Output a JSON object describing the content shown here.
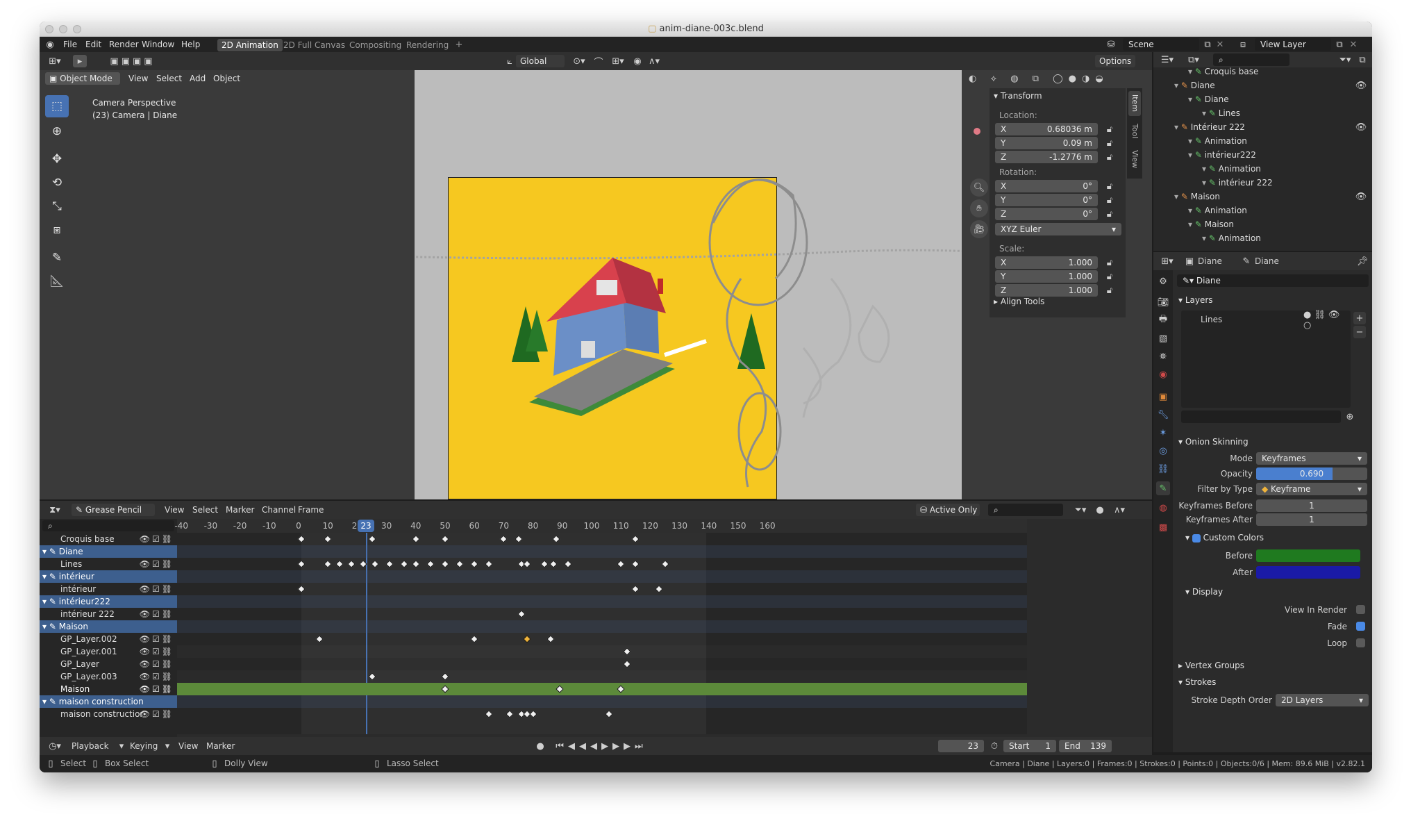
{
  "title": "anim-diane-003c.blend",
  "menu": [
    "File",
    "Edit",
    "Render",
    "Window",
    "Help"
  ],
  "workspaces": [
    {
      "label": "2D Animation",
      "active": true
    },
    {
      "label": "2D Full Canvas",
      "active": false
    },
    {
      "label": "Compositing",
      "active": false
    },
    {
      "label": "Rendering",
      "active": false
    }
  ],
  "scene": "Scene",
  "view_layer": "View Layer",
  "viewport": {
    "orientation": "Global",
    "options": "Options",
    "mode": "Object Mode",
    "menus": [
      "View",
      "Select",
      "Add",
      "Object"
    ],
    "info_line1": "Camera Perspective",
    "info_line2": "(23) Camera | Diane"
  },
  "npanel": {
    "tabs": [
      "Item",
      "Tool",
      "View"
    ],
    "transform_header": "Transform",
    "location_label": "Location:",
    "location": [
      {
        "axis": "X",
        "value": "0.68036 m"
      },
      {
        "axis": "Y",
        "value": "0.09 m"
      },
      {
        "axis": "Z",
        "value": "-1.2776 m"
      }
    ],
    "rotation_label": "Rotation:",
    "rotation": [
      {
        "axis": "X",
        "value": "0°"
      },
      {
        "axis": "Y",
        "value": "0°"
      },
      {
        "axis": "Z",
        "value": "0°"
      }
    ],
    "rotation_mode": "XYZ Euler",
    "scale_label": "Scale:",
    "scale": [
      {
        "axis": "X",
        "value": "1.000"
      },
      {
        "axis": "Y",
        "value": "1.000"
      },
      {
        "axis": "Z",
        "value": "1.000"
      }
    ],
    "align_tools": "Align Tools"
  },
  "outliner": {
    "items": [
      {
        "label": "Croquis base",
        "indent": 5
      },
      {
        "label": "Diane",
        "indent": 3
      },
      {
        "label": "Diane",
        "indent": 5
      },
      {
        "label": "Lines",
        "indent": 7
      },
      {
        "label": "Intérieur 222",
        "indent": 3
      },
      {
        "label": "Animation",
        "indent": 5
      },
      {
        "label": "intérieur222",
        "indent": 5
      },
      {
        "label": "Animation",
        "indent": 7
      },
      {
        "label": "intérieur 222",
        "indent": 7
      },
      {
        "label": "Maison",
        "indent": 3
      },
      {
        "label": "Animation",
        "indent": 5
      },
      {
        "label": "Maison",
        "indent": 5
      },
      {
        "label": "Animation",
        "indent": 7
      }
    ]
  },
  "properties": {
    "breadcrumb_object": "Diane",
    "breadcrumb_data": "Diane",
    "data_name": "Diane",
    "layers_header": "Layers",
    "layer_item": "Lines",
    "onion_header": "Onion Skinning",
    "mode_label": "Mode",
    "mode_value": "Keyframes",
    "opacity_label": "Opacity",
    "opacity_value": "0.690",
    "opacity_fraction": 0.69,
    "filter_label": "Filter by Type",
    "filter_value": "Keyframe",
    "kf_before_label": "Keyframes Before",
    "kf_before_value": "1",
    "kf_after_label": "Keyframes After",
    "kf_after_value": "1",
    "custom_colors": "Custom Colors",
    "before_label": "Before",
    "before_color": "#1f7a1f",
    "after_label": "After",
    "after_color": "#1a1aa6",
    "display_header": "Display",
    "view_in_render": "View In Render",
    "fade": "Fade",
    "loop": "Loop",
    "vertex_groups": "Vertex Groups",
    "strokes": "Strokes",
    "stroke_depth_label": "Stroke Depth Order",
    "stroke_depth_value": "2D Layers"
  },
  "dopesheet": {
    "mode": "Grease Pencil",
    "menus": [
      "View",
      "Select",
      "Marker",
      "Channel",
      "Frame"
    ],
    "active_only": "Active Only",
    "current_frame": 23,
    "current_frame_label": "23",
    "ticks": [
      "-40",
      "-30",
      "-20",
      "-10",
      "0",
      "10",
      "20",
      "30",
      "40",
      "50",
      "60",
      "70",
      "80",
      "90",
      "100",
      "110",
      "120",
      "130",
      "140",
      "150",
      "160"
    ],
    "tick_values": [
      -40,
      -30,
      -20,
      -10,
      0,
      10,
      20,
      30,
      40,
      50,
      60,
      70,
      80,
      90,
      100,
      110,
      120,
      130,
      140,
      150,
      160
    ],
    "channels": [
      {
        "label": "Croquis base",
        "group": false,
        "keys": [
          1,
          10,
          25,
          40,
          50,
          70,
          75,
          88,
          115
        ]
      },
      {
        "label": "Diane",
        "group": true,
        "keys": []
      },
      {
        "label": "Lines",
        "group": false,
        "keys": [
          1,
          10,
          14,
          18,
          22,
          26,
          31,
          36,
          40,
          45,
          50,
          55,
          60,
          65,
          76,
          78,
          84,
          87,
          92,
          110,
          115,
          125
        ]
      },
      {
        "label": "intérieur",
        "group": true,
        "keys": []
      },
      {
        "label": "intérieur",
        "group": false,
        "keys": [
          1,
          115,
          123
        ]
      },
      {
        "label": "intérieur222",
        "group": true,
        "keys": []
      },
      {
        "label": "intérieur 222",
        "group": false,
        "keys": [
          76
        ]
      },
      {
        "label": "Maison",
        "group": true,
        "keys": []
      },
      {
        "label": "GP_Layer.002",
        "group": false,
        "keys": [
          7,
          60,
          78,
          86
        ],
        "selected_keys": [
          78
        ]
      },
      {
        "label": "GP_Layer.001",
        "group": false,
        "keys": [
          112
        ]
      },
      {
        "label": "GP_Layer",
        "group": false,
        "keys": [
          112
        ]
      },
      {
        "label": "GP_Layer.003",
        "group": false,
        "keys": [
          25,
          50
        ]
      },
      {
        "label": "Maison",
        "group": false,
        "active": true,
        "keys": [
          50,
          89,
          110
        ]
      },
      {
        "label": "maison construction",
        "group": true,
        "keys": []
      },
      {
        "label": "maison constructior",
        "group": false,
        "keys": [
          65,
          72,
          76,
          78,
          80,
          106
        ]
      }
    ]
  },
  "timeline": {
    "playback": "Playback",
    "keying": "Keying",
    "view": "View",
    "marker": "Marker",
    "frame": "23",
    "start_label": "Start",
    "start": "1",
    "end_label": "End",
    "end": "139"
  },
  "statusbar": {
    "select": "Select",
    "box_select": "Box Select",
    "dolly_view": "Dolly View",
    "lasso_select": "Lasso Select",
    "stats": "Camera | Diane | Layers:0 | Frames:0 | Strokes:0 | Points:0 | Objects:0/6 | Mem: 89.6 MiB | v2.82.1"
  }
}
